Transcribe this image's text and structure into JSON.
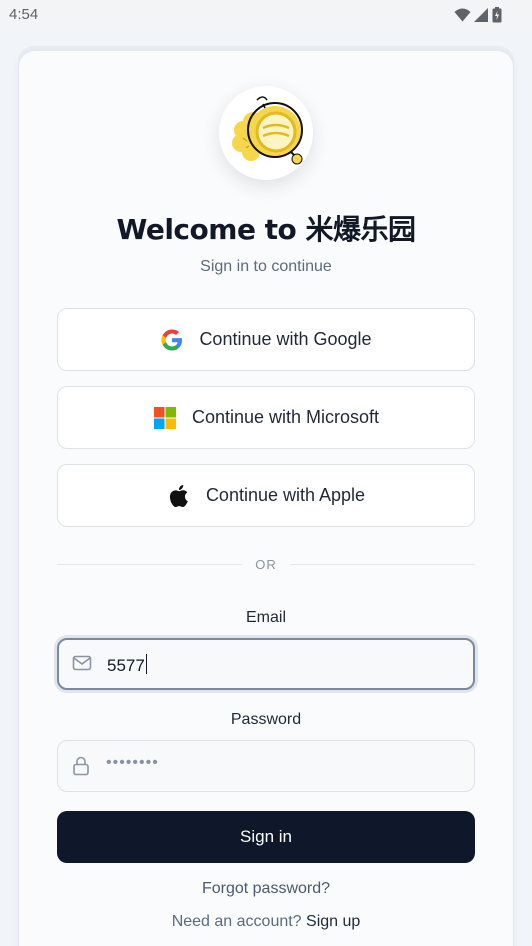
{
  "status_bar": {
    "time": "4:54",
    "icons": [
      "wifi-icon",
      "signal-icon",
      "battery-icon"
    ]
  },
  "header": {
    "title": "Welcome to 米爆乐园",
    "subtitle": "Sign in to continue"
  },
  "oauth": {
    "google_label": "Continue with Google",
    "microsoft_label": "Continue with Microsoft",
    "apple_label": "Continue with Apple"
  },
  "divider": {
    "text": "OR"
  },
  "form": {
    "email_label": "Email",
    "email_value": "5577",
    "password_label": "Password",
    "password_value": "••••••••"
  },
  "actions": {
    "signin_label": "Sign in",
    "forgot_label": "Forgot password?",
    "need_account_text": "Need an account?",
    "signup_label": "Sign up"
  },
  "colors": {
    "primary": "#0f172a",
    "card_bg": "#fafbfc",
    "page_bg": "#f1f4f8",
    "logo_yellow": "#f6d64a",
    "microsoft_red": "#f25022",
    "microsoft_green": "#7fba00",
    "microsoft_blue": "#00a4ef",
    "microsoft_yellow": "#ffb900"
  }
}
